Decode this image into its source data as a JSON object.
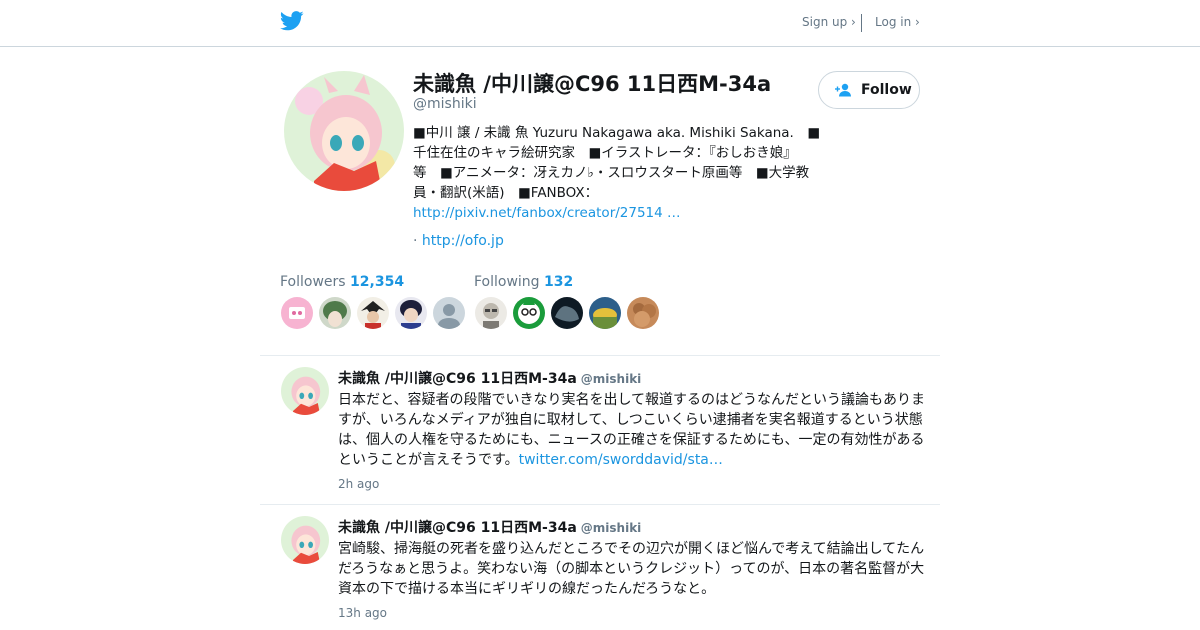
{
  "topbar": {
    "signup_label": "Sign up ›",
    "login_label": "Log in ›"
  },
  "profile": {
    "name": "未識魚 /中川譲@C96 11日西M-34a",
    "handle": "@mishiki",
    "follow_label": "Follow",
    "bio_lines": [
      "■中川 譲 / 未識 魚 Yuzuru Nakagawa aka. Mishiki Sakana.　■",
      "千住在住のキャラ絵研究家　■イラストレータ：『おしおき娘』",
      "等　■アニメータ：冴えカノ♭・スロウスタート原画等　■大学教",
      "員・翻訳(米語)　■FANBOX："
    ],
    "bio_link": "http://pixiv.net/fanbox/creator/27514 …",
    "website_prefix": "· ",
    "website": "http://ofo.jp"
  },
  "stats": {
    "followers_label": "Followers",
    "followers_count": "12,354",
    "following_label": "Following",
    "following_count": "132"
  },
  "tweets": [
    {
      "name": "未識魚 /中川譲@C96 11日西M-34a",
      "handle": "@mishiki",
      "lines": [
        "日本だと、容疑者の段階でいきなり実名を出して報道するのはどうなんだという議論もありま",
        "すが、いろんなメディアが独自に取材して、しつこいくらい逮捕者を実名報道するという状態",
        "は、個人の人権を守るためにも、ニュースの正確さを保証するためにも、一定の有効性がある",
        "ということが言えそうです。"
      ],
      "link": "twitter.com/sworddavid/sta…",
      "time": "2h ago"
    },
    {
      "name": "未識魚 /中川譲@C96 11日西M-34a",
      "handle": "@mishiki",
      "lines": [
        "宮崎駿、掃海艇の死者を盛り込んだところでその辺穴が開くほど悩んで考えて結論出してたん",
        "だろうなぁと思うよ。笑わない海（の脚本というクレジット）ってのが、日本の著名監督が大",
        "資本の下で描ける本当にギリギリの線だったんだろうなと。"
      ],
      "time": "13h ago"
    }
  ],
  "colors": {
    "accent": "#1b95e0",
    "twitter_blue": "#1da1f2",
    "muted": "#657786",
    "border": "#e6ecf0"
  },
  "icons": [
    "twitter-bird-icon",
    "add-person-icon"
  ]
}
